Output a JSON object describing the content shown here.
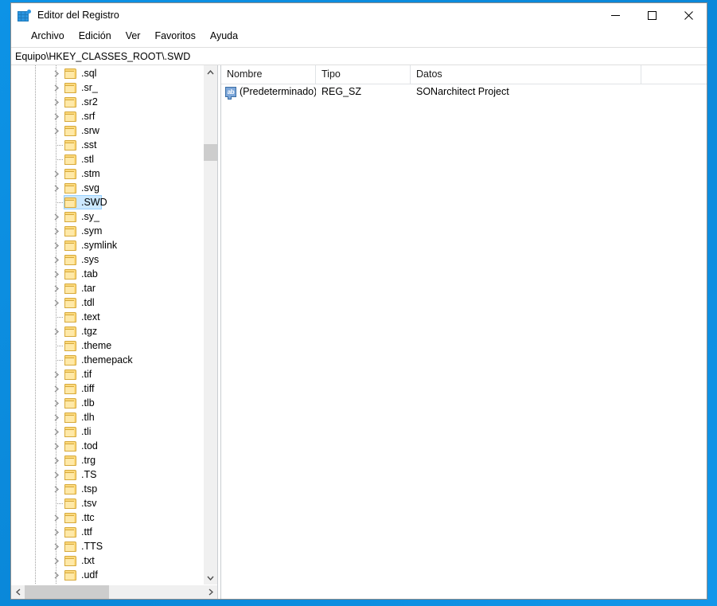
{
  "window": {
    "title": "Editor del Registro",
    "icon": "registry-editor-icon",
    "controls": {
      "minimize": "minimize-icon",
      "maximize": "maximize-icon",
      "close": "close-icon"
    }
  },
  "menu": {
    "items": [
      {
        "label": "Archivo"
      },
      {
        "label": "Edición"
      },
      {
        "label": "Ver"
      },
      {
        "label": "Favoritos"
      },
      {
        "label": "Ayuda"
      }
    ]
  },
  "address": {
    "path": "Equipo\\HKEY_CLASSES_ROOT\\.SWD"
  },
  "tree": {
    "selected_key": ".SWD",
    "selection_color": "#cce8ff",
    "items": [
      {
        "label": ".sql",
        "expandable": true,
        "selected": false
      },
      {
        "label": ".sr_",
        "expandable": true,
        "selected": false
      },
      {
        "label": ".sr2",
        "expandable": true,
        "selected": false
      },
      {
        "label": ".srf",
        "expandable": true,
        "selected": false
      },
      {
        "label": ".srw",
        "expandable": true,
        "selected": false
      },
      {
        "label": ".sst",
        "expandable": false,
        "selected": false
      },
      {
        "label": ".stl",
        "expandable": false,
        "selected": false
      },
      {
        "label": ".stm",
        "expandable": true,
        "selected": false
      },
      {
        "label": ".svg",
        "expandable": true,
        "selected": false
      },
      {
        "label": ".SWD",
        "expandable": false,
        "selected": true
      },
      {
        "label": ".sy_",
        "expandable": true,
        "selected": false
      },
      {
        "label": ".sym",
        "expandable": true,
        "selected": false
      },
      {
        "label": ".symlink",
        "expandable": true,
        "selected": false
      },
      {
        "label": ".sys",
        "expandable": true,
        "selected": false
      },
      {
        "label": ".tab",
        "expandable": true,
        "selected": false
      },
      {
        "label": ".tar",
        "expandable": true,
        "selected": false
      },
      {
        "label": ".tdl",
        "expandable": true,
        "selected": false
      },
      {
        "label": ".text",
        "expandable": false,
        "selected": false
      },
      {
        "label": ".tgz",
        "expandable": true,
        "selected": false
      },
      {
        "label": ".theme",
        "expandable": false,
        "selected": false
      },
      {
        "label": ".themepack",
        "expandable": false,
        "selected": false
      },
      {
        "label": ".tif",
        "expandable": true,
        "selected": false
      },
      {
        "label": ".tiff",
        "expandable": true,
        "selected": false
      },
      {
        "label": ".tlb",
        "expandable": true,
        "selected": false
      },
      {
        "label": ".tlh",
        "expandable": true,
        "selected": false
      },
      {
        "label": ".tli",
        "expandable": true,
        "selected": false
      },
      {
        "label": ".tod",
        "expandable": true,
        "selected": false
      },
      {
        "label": ".trg",
        "expandable": true,
        "selected": false
      },
      {
        "label": ".TS",
        "expandable": true,
        "selected": false
      },
      {
        "label": ".tsp",
        "expandable": true,
        "selected": false
      },
      {
        "label": ".tsv",
        "expandable": false,
        "selected": false
      },
      {
        "label": ".ttc",
        "expandable": true,
        "selected": false
      },
      {
        "label": ".ttf",
        "expandable": true,
        "selected": false
      },
      {
        "label": ".TTS",
        "expandable": true,
        "selected": false
      },
      {
        "label": ".txt",
        "expandable": true,
        "selected": false
      },
      {
        "label": ".udf",
        "expandable": true,
        "selected": false
      }
    ],
    "scroll": {
      "vertical_up_icon": "chevron-up-icon",
      "vertical_down_icon": "chevron-down-icon",
      "horizontal_left_icon": "chevron-left-icon",
      "horizontal_right_icon": "chevron-right-icon"
    }
  },
  "values": {
    "columns": [
      "Nombre",
      "Tipo",
      "Datos"
    ],
    "rows": [
      {
        "icon": "string-value-icon",
        "icon_text": "ab",
        "name": "(Predeterminado)",
        "type": "REG_SZ",
        "data": "SONarchitect Project"
      }
    ]
  }
}
